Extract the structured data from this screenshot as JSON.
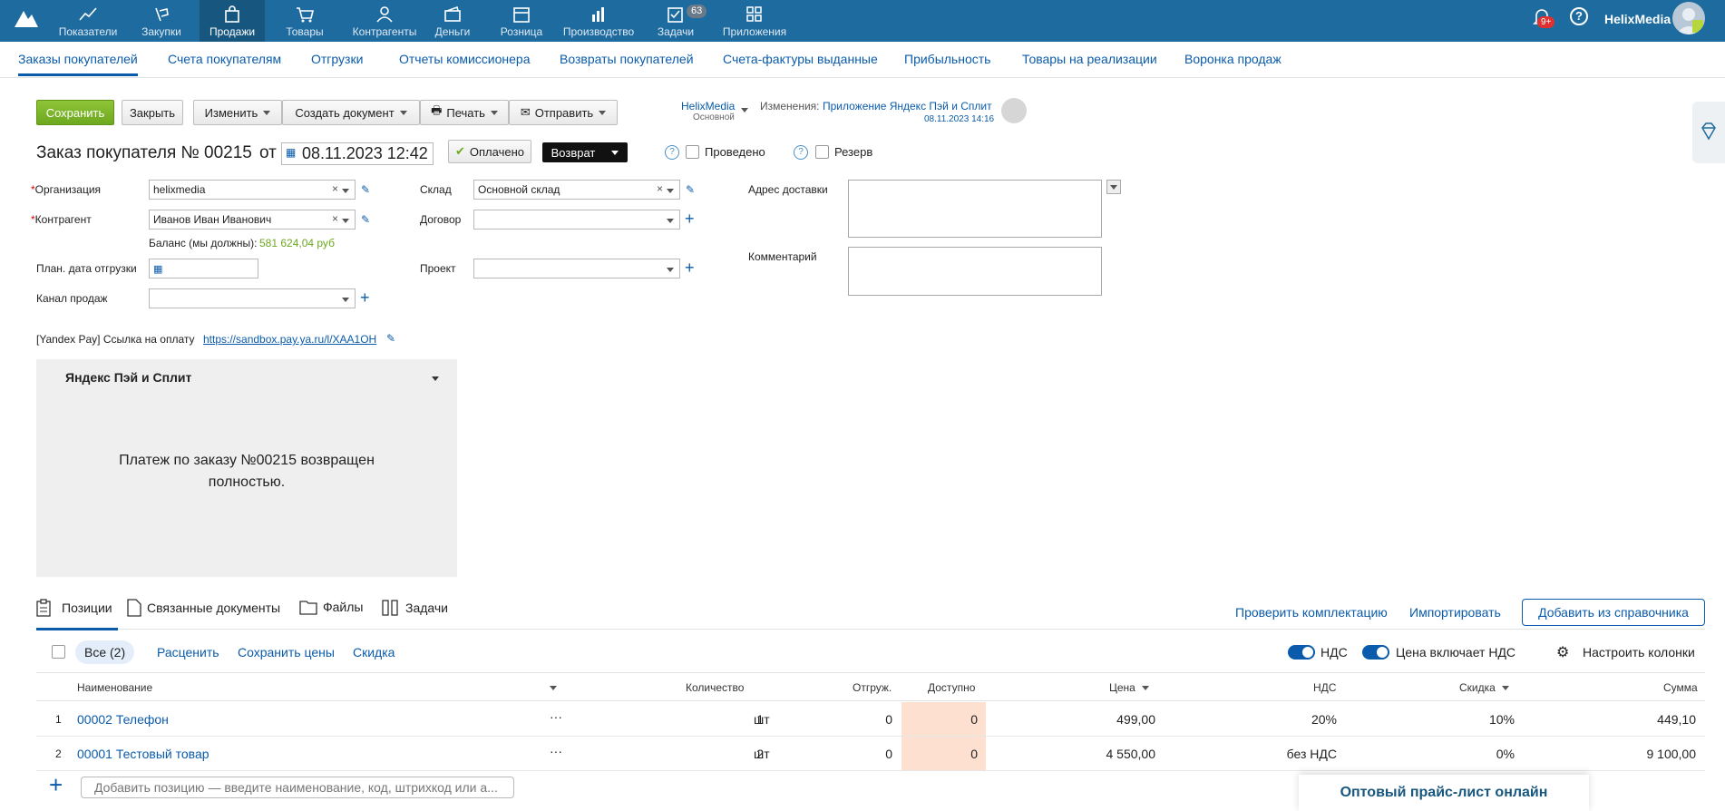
{
  "topnav": {
    "items": [
      {
        "label": "Показатели",
        "icon": "chart-line-icon"
      },
      {
        "label": "Закупки",
        "icon": "purchase-icon"
      },
      {
        "label": "Продажи",
        "icon": "bag-icon"
      },
      {
        "label": "Товары",
        "icon": "cart-icon"
      },
      {
        "label": "Контрагенты",
        "icon": "people-icon"
      },
      {
        "label": "Деньги",
        "icon": "wallet-icon"
      },
      {
        "label": "Розница",
        "icon": "store-icon"
      },
      {
        "label": "Производство",
        "icon": "factory-icon"
      },
      {
        "label": "Задачи",
        "icon": "tasks-icon"
      },
      {
        "label": "Приложения",
        "icon": "apps-icon"
      }
    ],
    "tasks_badge": "63",
    "notifications_badge": "9+",
    "username": "HelixMedia"
  },
  "subnav": [
    "Заказы покупателей",
    "Счета покупателям",
    "Отгрузки",
    "Отчеты комиссионера",
    "Возвраты покупателей",
    "Счета-фактуры выданные",
    "Прибыльность",
    "Товары на реализации",
    "Воронка продаж"
  ],
  "toolbar": {
    "save": "Сохранить",
    "close": "Закрыть",
    "edit": "Изменить",
    "create_doc": "Создать документ",
    "print": "Печать",
    "send": "Отправить",
    "owner": "HelixMedia",
    "owner_sub": "Основной",
    "changes_label": "Изменения:",
    "changes_link": "Приложение Яндекс Пэй и Сплит",
    "changes_date": "08.11.2023 14:16"
  },
  "doc": {
    "title": "Заказ покупателя №",
    "number": "00215",
    "from": "от",
    "date": "08.11.2023 12:42",
    "paid": "Оплачено",
    "return": "Возврат",
    "posted": "Проведено",
    "reserve": "Резерв"
  },
  "form": {
    "org_label": "Организация",
    "org_value": "helixmedia",
    "contractor_label": "Контрагент",
    "contractor_value": "Иванов Иван Иванович",
    "balance_label": "Баланс (мы должны):",
    "balance_value": "581 624,04 руб",
    "ship_date_label": "План. дата отгрузки",
    "channel_label": "Канал продаж",
    "warehouse_label": "Склад",
    "warehouse_value": "Основной склад",
    "contract_label": "Договор",
    "project_label": "Проект",
    "address_label": "Адрес доставки",
    "comment_label": "Комментарий",
    "yandex_label": "[Yandex Pay] Ссылка на оплату",
    "yandex_link": "https://sandbox.pay.ya.ru/l/XAA1OH"
  },
  "widget": {
    "title": "Яндекс Пэй и Сплит",
    "message_line1": "Платеж по заказу №00215 возвращен",
    "message_line2": "полностью."
  },
  "tabs": [
    "Позиции",
    "Связанные документы",
    "Файлы",
    "Задачи"
  ],
  "actions": {
    "check": "Проверить комплектацию",
    "import": "Импортировать",
    "add_from_catalog": "Добавить из справочника"
  },
  "filters": {
    "all": "Все (2)",
    "reprice": "Расценить",
    "save_prices": "Сохранить цены",
    "discount": "Скидка",
    "vat": "НДС",
    "price_incl_vat": "Цена включает НДС",
    "columns": "Настроить колонки"
  },
  "table": {
    "headers": {
      "name": "Наименование",
      "qty": "Количество",
      "shipped": "Отгруж.",
      "available": "Доступно",
      "price": "Цена",
      "vat": "НДС",
      "discount": "Скидка",
      "sum": "Сумма"
    },
    "rows": [
      {
        "n": "1",
        "name": "00002 Телефон",
        "qty": "1",
        "unit": "шт",
        "shipped": "0",
        "available": "0",
        "price": "499,00",
        "vat": "20%",
        "discount": "10%",
        "sum": "449,10"
      },
      {
        "n": "2",
        "name": "00001 Тестовый товар",
        "qty": "2",
        "unit": "шт",
        "shipped": "0",
        "available": "0",
        "price": "4 550,00",
        "vat": "без НДС",
        "discount": "0%",
        "sum": "9 100,00"
      }
    ],
    "add_placeholder": "Добавить позицию — введите наименование, код, штрихкод или а..."
  },
  "promo": "Оптовый прайс-лист онлайн",
  "colors": {
    "topbar": "#1e6ba0",
    "link": "#0a5bab",
    "save": "#7ab52a",
    "available_bg": "#fde0d0"
  }
}
